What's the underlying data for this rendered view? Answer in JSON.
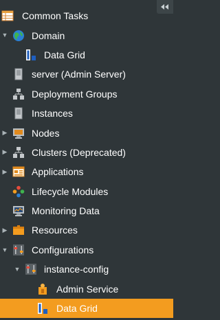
{
  "tree": {
    "common_tasks": "Common Tasks",
    "domain": "Domain",
    "domain_data_grid": "Data Grid",
    "server": "server (Admin Server)",
    "deployment_groups": "Deployment Groups",
    "instances": "Instances",
    "nodes": "Nodes",
    "clusters": "Clusters (Deprecated)",
    "applications": "Applications",
    "lifecycle_modules": "Lifecycle Modules",
    "monitoring_data": "Monitoring Data",
    "resources": "Resources",
    "configurations": "Configurations",
    "instance_config": "instance-config",
    "admin_service": "Admin Service",
    "config_data_grid": "Data Grid"
  },
  "colors": {
    "background": "#2f3639",
    "selected": "#f39c1f",
    "text": "#ffffff"
  }
}
